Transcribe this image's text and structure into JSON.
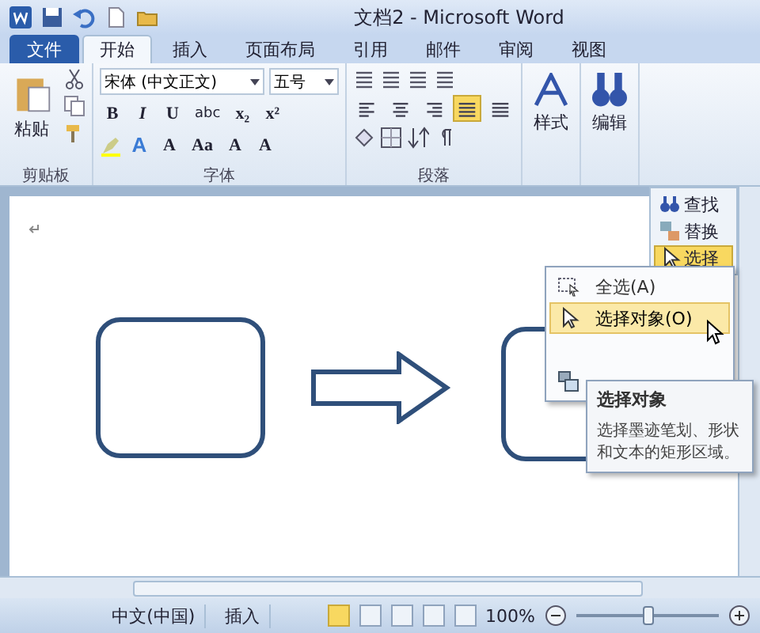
{
  "title_bar": {
    "title": "文档2 - Microsoft Word"
  },
  "tabs": [
    {
      "label": "文件",
      "kind": "file",
      "selected": false
    },
    {
      "label": "开始",
      "kind": "tab",
      "selected": true
    },
    {
      "label": "插入",
      "kind": "tab",
      "selected": false
    },
    {
      "label": "页面布局",
      "kind": "tab",
      "selected": false
    },
    {
      "label": "引用",
      "kind": "tab",
      "selected": false
    },
    {
      "label": "邮件",
      "kind": "tab",
      "selected": false
    },
    {
      "label": "审阅",
      "kind": "tab",
      "selected": false
    },
    {
      "label": "视图",
      "kind": "tab",
      "selected": false
    }
  ],
  "ribbon": {
    "clipboard": {
      "title": "剪贴板",
      "paste": "粘贴"
    },
    "font": {
      "title": "字体",
      "font_name": "宋体 (中文正文)",
      "font_size": "五号",
      "row_1": [
        "B",
        "I",
        "U",
        "abc",
        "x₂",
        "x²"
      ],
      "row_2": [
        "A",
        "A",
        "Aa",
        "A",
        "A"
      ]
    },
    "paragraph": {
      "title": "段落",
      "alignments": [
        {
          "selected": false
        },
        {
          "selected": false
        },
        {
          "selected": false
        },
        {
          "selected": true
        },
        {
          "selected": false
        }
      ]
    },
    "styles": {
      "label": "样式"
    },
    "editing": {
      "label": "编辑"
    }
  },
  "editing_panel": [
    {
      "label": "查找",
      "kind": "find",
      "selected": false
    },
    {
      "label": "替换",
      "kind": "replace",
      "selected": false
    },
    {
      "label": "选择",
      "kind": "select",
      "selected": true
    }
  ],
  "select_menu": [
    {
      "label": "全选(A)",
      "kind": "select-all",
      "selected": false
    },
    {
      "label": "选择对象(O)",
      "kind": "select-objects",
      "selected": true
    },
    {
      "kind": "covered"
    },
    {
      "kind": "selection-pane",
      "selected": false
    }
  ],
  "tooltip": {
    "title": "选择对象",
    "text": "选择墨迹笔划、形状和文本的矩形区域。"
  },
  "status_bar": {
    "language": "中文(中国)",
    "mode": "插入",
    "views": [
      {
        "selected": true
      },
      {
        "selected": false
      },
      {
        "selected": false
      },
      {
        "selected": false
      },
      {
        "selected": false
      }
    ],
    "zoom": "100%",
    "zoom_level": {
      "level": 0.5
    }
  }
}
